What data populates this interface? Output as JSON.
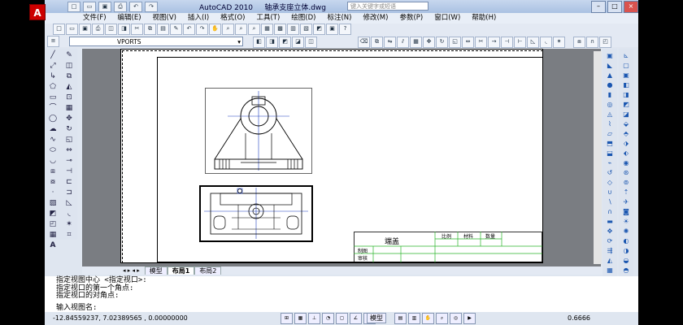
{
  "app": {
    "logo": "A",
    "title": "AutoCAD 2010",
    "filename": "轴承支座立体.dwg",
    "search_placeholder": "键入关键字或短语"
  },
  "menu": [
    "文件(F)",
    "编辑(E)",
    "视图(V)",
    "插入(I)",
    "格式(O)",
    "工具(T)",
    "绘图(D)",
    "标注(N)",
    "修改(M)",
    "参数(P)",
    "窗口(W)",
    "帮助(H)"
  ],
  "layer": {
    "current": "VPORTS"
  },
  "tabs": {
    "model": "模型",
    "layout1": "布局1",
    "layout2": "布局2"
  },
  "title_block": {
    "part_name": "端盖",
    "scale": "比例",
    "material": "材料",
    "quantity": "数量",
    "drawn": "制图",
    "checked": "审核"
  },
  "command": {
    "line1": "指定视图中心 <指定视口>:",
    "line2": "指定视口的第一个角点:",
    "line3": "指定视口的对角点:",
    "prompt": "输入视图名:"
  },
  "status": {
    "coords": "-12.84559237,  7.02389565 , 0.00000000",
    "model_button": "模型",
    "scale": "0.6666"
  },
  "icons": {
    "minimize": "minimize-icon",
    "maximize": "maximize-icon",
    "close": "close-icon"
  }
}
